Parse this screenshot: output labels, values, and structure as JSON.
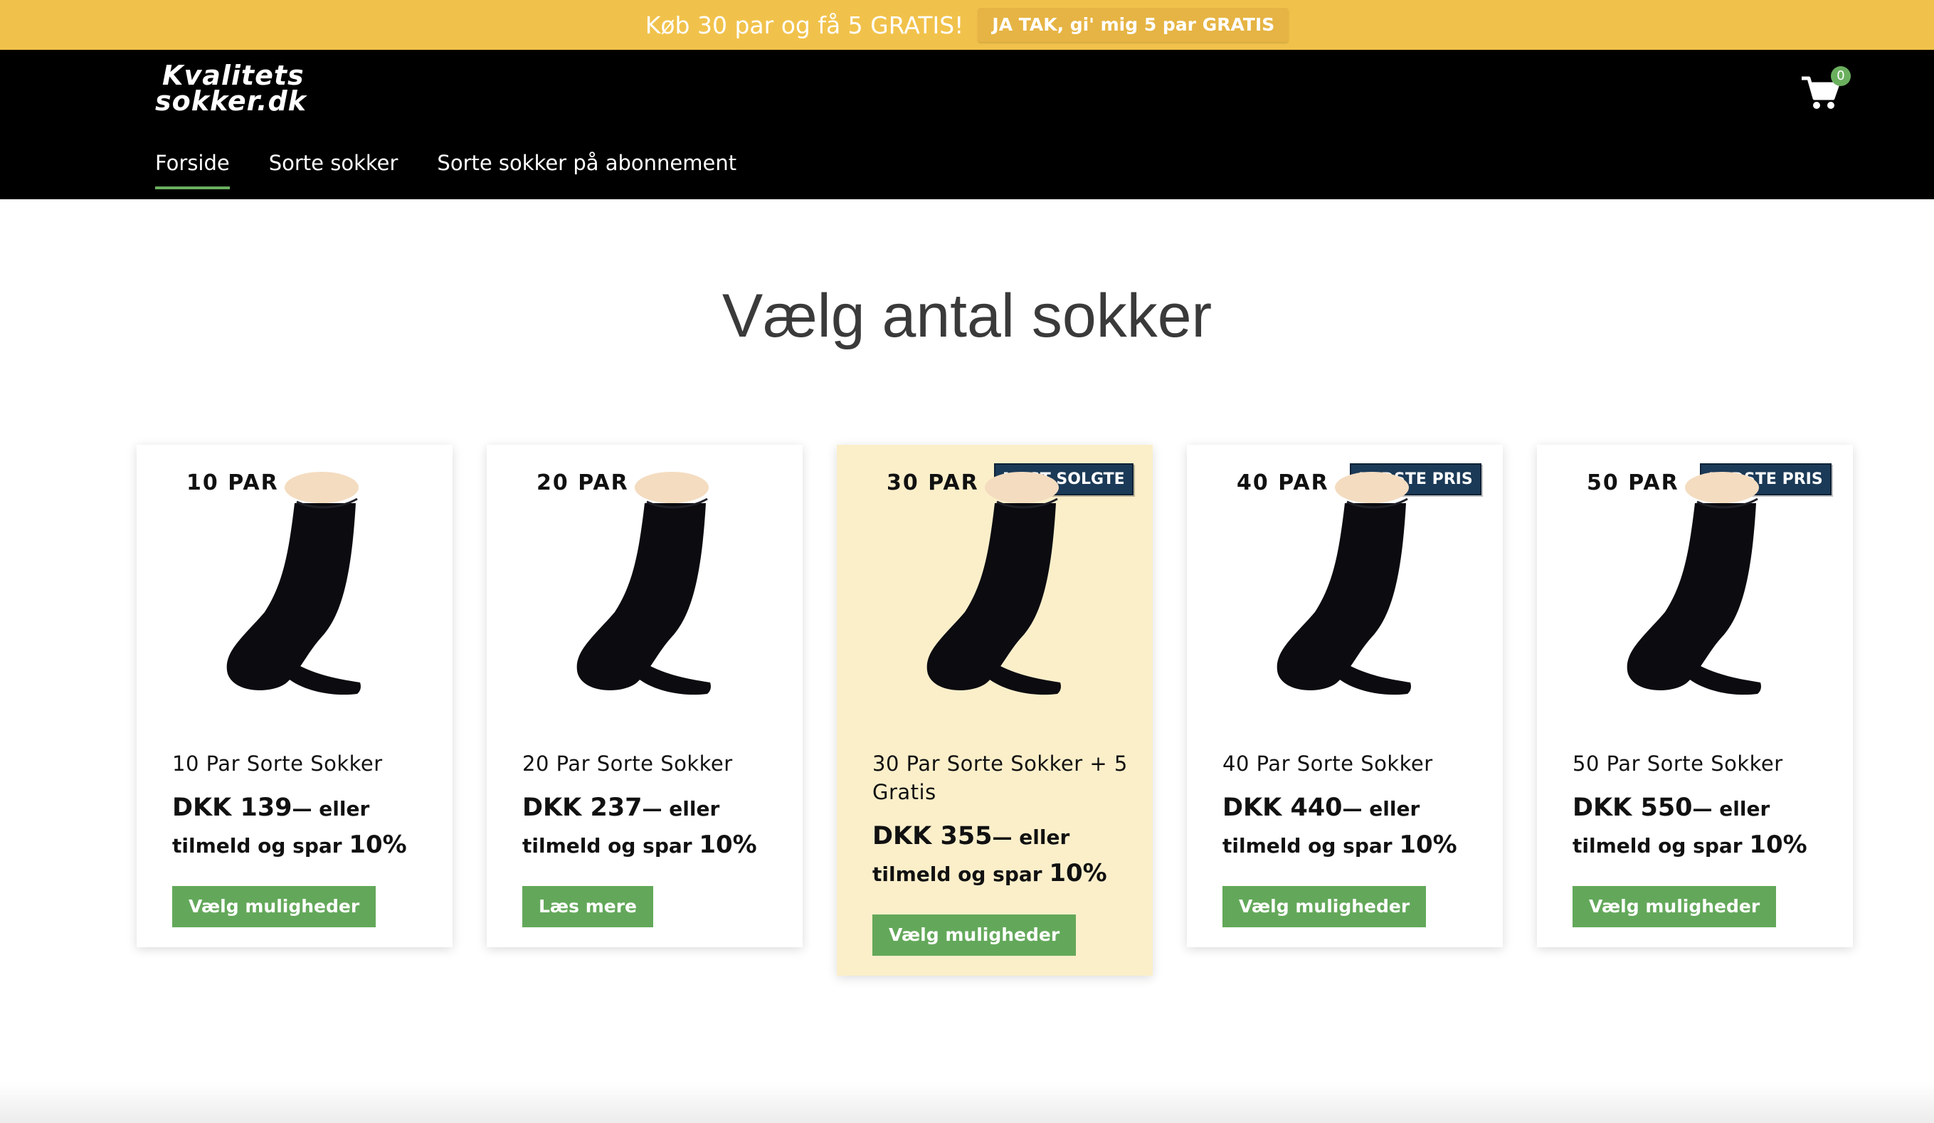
{
  "promo": {
    "text": "Køb 30 par og få 5 GRATIS!",
    "button_label": "JA TAK, gi' mig 5 par GRATIS",
    "bg_color": "#f1c24b"
  },
  "header": {
    "logo_line1": "Kvalitets",
    "logo_line2": "sokker.dk",
    "nav": [
      {
        "label": "Forside",
        "active": true
      },
      {
        "label": "Sorte sokker",
        "active": false
      },
      {
        "label": "Sorte sokker på abonnement",
        "active": false
      }
    ],
    "cart_icon": "cart-icon",
    "cart_count": "0"
  },
  "main": {
    "title": "Vælg antal sokker",
    "products": [
      {
        "qty": "10 PAR",
        "badge": "",
        "name": "10 Par Sorte Sokker",
        "price": "DKK 139",
        "price_suffix": "— eller",
        "subscribe": "tilmeld og spar",
        "discount": "10%",
        "button": "Vælg muligheder"
      },
      {
        "qty": "20 PAR",
        "badge": "",
        "name": "20 Par Sorte Sokker",
        "price": "DKK 237",
        "price_suffix": "— eller",
        "subscribe": "tilmeld og spar",
        "discount": "10%",
        "button": "Læs mere"
      },
      {
        "qty": "30 PAR",
        "badge": "MEST SOLGTE",
        "name": "30 Par Sorte Sokker + 5 Gratis",
        "price": "DKK 355",
        "price_suffix": "— eller",
        "subscribe": "tilmeld og spar",
        "discount": "10%",
        "button": "Vælg muligheder"
      },
      {
        "qty": "40 PAR",
        "badge": "BEDSTE PRIS",
        "name": "40 Par Sorte Sokker",
        "price": "DKK 440",
        "price_suffix": "— eller",
        "subscribe": "tilmeld og spar",
        "discount": "10%",
        "button": "Vælg muligheder"
      },
      {
        "qty": "50 PAR",
        "badge": "BEDSTE PRIS",
        "name": "50 Par Sorte Sokker",
        "price": "DKK 550",
        "price_suffix": "— eller",
        "subscribe": "tilmeld og spar",
        "discount": "10%",
        "button": "Vælg muligheder"
      }
    ]
  },
  "colors": {
    "accent_green": "#63a85a",
    "badge_navy": "#1b3a57",
    "highlight_card": "#fbefca"
  }
}
